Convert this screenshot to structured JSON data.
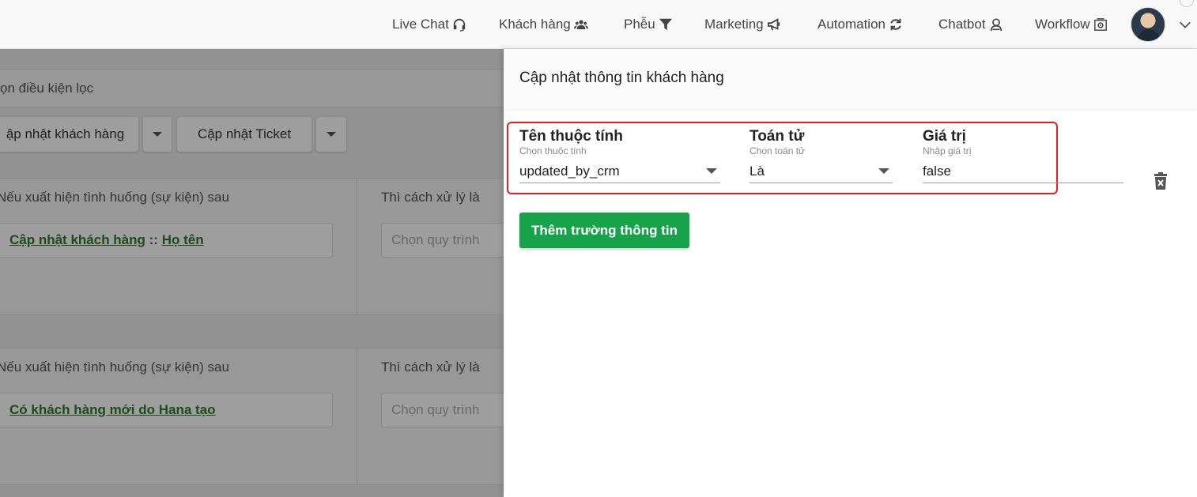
{
  "nav": {
    "items": [
      {
        "label": "Live Chat",
        "icon": "headset-icon"
      },
      {
        "label": "Khách hàng",
        "icon": "users-icon"
      },
      {
        "label": "Phễu",
        "icon": "funnel-icon"
      },
      {
        "label": "Marketing",
        "icon": "megaphone-icon"
      },
      {
        "label": "Automation",
        "icon": "refresh-icon"
      },
      {
        "label": "Chatbot",
        "icon": "bot-icon"
      },
      {
        "label": "Workflow",
        "icon": "workflow-icon"
      }
    ]
  },
  "background": {
    "filter_text": "ọn điều kiện lọc",
    "buttons": {
      "update_customer": "ập nhật khách hàng",
      "update_ticket": "Cập nhật Ticket"
    },
    "rules": [
      {
        "condition_title": "Nếu xuất hiện tình huống (sự kiện) sau",
        "action_title": "Thì cách xử lý là",
        "event_part1": "Cập nhật khách hàng",
        "event_sep": " :: ",
        "event_part2": "Họ tên",
        "process_placeholder": "Chọn quy trình"
      },
      {
        "condition_title": "Nếu xuất hiện tình huống (sự kiện) sau",
        "action_title": "Thì cách xử lý là",
        "event_part1": "Có khách hàng mới do Hana tạo",
        "process_placeholder": "Chọn quy trình"
      }
    ]
  },
  "panel": {
    "title": "Cập nhật thông tin khách hàng",
    "fields": {
      "attribute": {
        "label": "Tên thuộc tính",
        "hint": "Chọn thuộc tính",
        "value": "updated_by_crm"
      },
      "operator": {
        "label": "Toán tử",
        "hint": "Chọn toán tử",
        "value": "Là"
      },
      "value": {
        "label": "Giá trị",
        "hint": "Nhập giá trị",
        "value": "false"
      }
    },
    "add_button": "Thêm trường thông tin"
  },
  "colors": {
    "primary_green": "#16a34a",
    "highlight_red": "#e02020",
    "link_green": "#2d7a2d"
  }
}
